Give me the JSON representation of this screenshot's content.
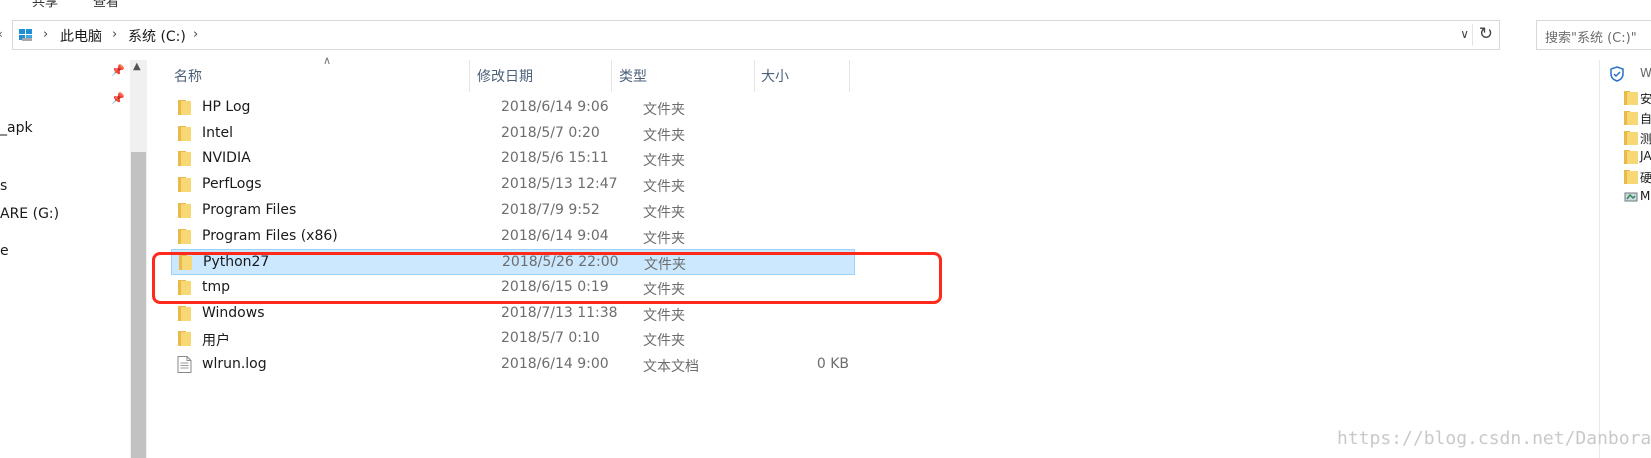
{
  "ribbon": {
    "tabs": [
      "共享",
      "查看"
    ]
  },
  "address_bar": {
    "breadcrumbs": [
      "此电脑",
      "系统 (C:)"
    ],
    "search_placeholder": "搜索\"系统 (C:)\""
  },
  "nav_pane": {
    "items": [
      "_apk",
      "s",
      "ARE (G:)",
      "e"
    ]
  },
  "file_list": {
    "columns": {
      "name": "名称",
      "date": "修改日期",
      "type": "类型",
      "size": "大小"
    },
    "rows": [
      {
        "name": "HP Log",
        "date": "2018/6/14 9:06",
        "type": "文件夹",
        "size": "",
        "icon": "folder-icon"
      },
      {
        "name": "Intel",
        "date": "2018/5/7 0:20",
        "type": "文件夹",
        "size": "",
        "icon": "folder-icon"
      },
      {
        "name": "NVIDIA",
        "date": "2018/5/6 15:11",
        "type": "文件夹",
        "size": "",
        "icon": "folder-icon"
      },
      {
        "name": "PerfLogs",
        "date": "2018/5/13 12:47",
        "type": "文件夹",
        "size": "",
        "icon": "folder-icon"
      },
      {
        "name": "Program Files",
        "date": "2018/7/9 9:52",
        "type": "文件夹",
        "size": "",
        "icon": "folder-icon"
      },
      {
        "name": "Program Files (x86)",
        "date": "2018/6/14 9:04",
        "type": "文件夹",
        "size": "",
        "icon": "folder-icon"
      },
      {
        "name": "Python27",
        "date": "2018/5/26 22:00",
        "type": "文件夹",
        "size": "",
        "icon": "folder-icon",
        "selected": true
      },
      {
        "name": "tmp",
        "date": "2018/6/15 0:19",
        "type": "文件夹",
        "size": "",
        "icon": "folder-icon"
      },
      {
        "name": "Windows",
        "date": "2018/7/13 11:38",
        "type": "文件夹",
        "size": "",
        "icon": "folder-icon"
      },
      {
        "name": "用户",
        "date": "2018/5/7 0:10",
        "type": "文件夹",
        "size": "",
        "icon": "folder-icon"
      },
      {
        "name": "wlrun.log",
        "date": "2018/6/14 9:00",
        "type": "文本文档",
        "size": "0 KB",
        "icon": "text-file-icon"
      }
    ]
  },
  "right_pane": {
    "items": [
      "W",
      "安",
      "自",
      "测",
      "JA",
      "硬",
      "M"
    ]
  },
  "watermark": "https://blog.csdn.net/Danborad",
  "colors": {
    "selection_fill": "#cce8ff",
    "selection_border": "#99d1ff",
    "annotation_red": "#ff2a1c",
    "folder_yellow": "#f8d775",
    "header_text": "#4c607a"
  }
}
